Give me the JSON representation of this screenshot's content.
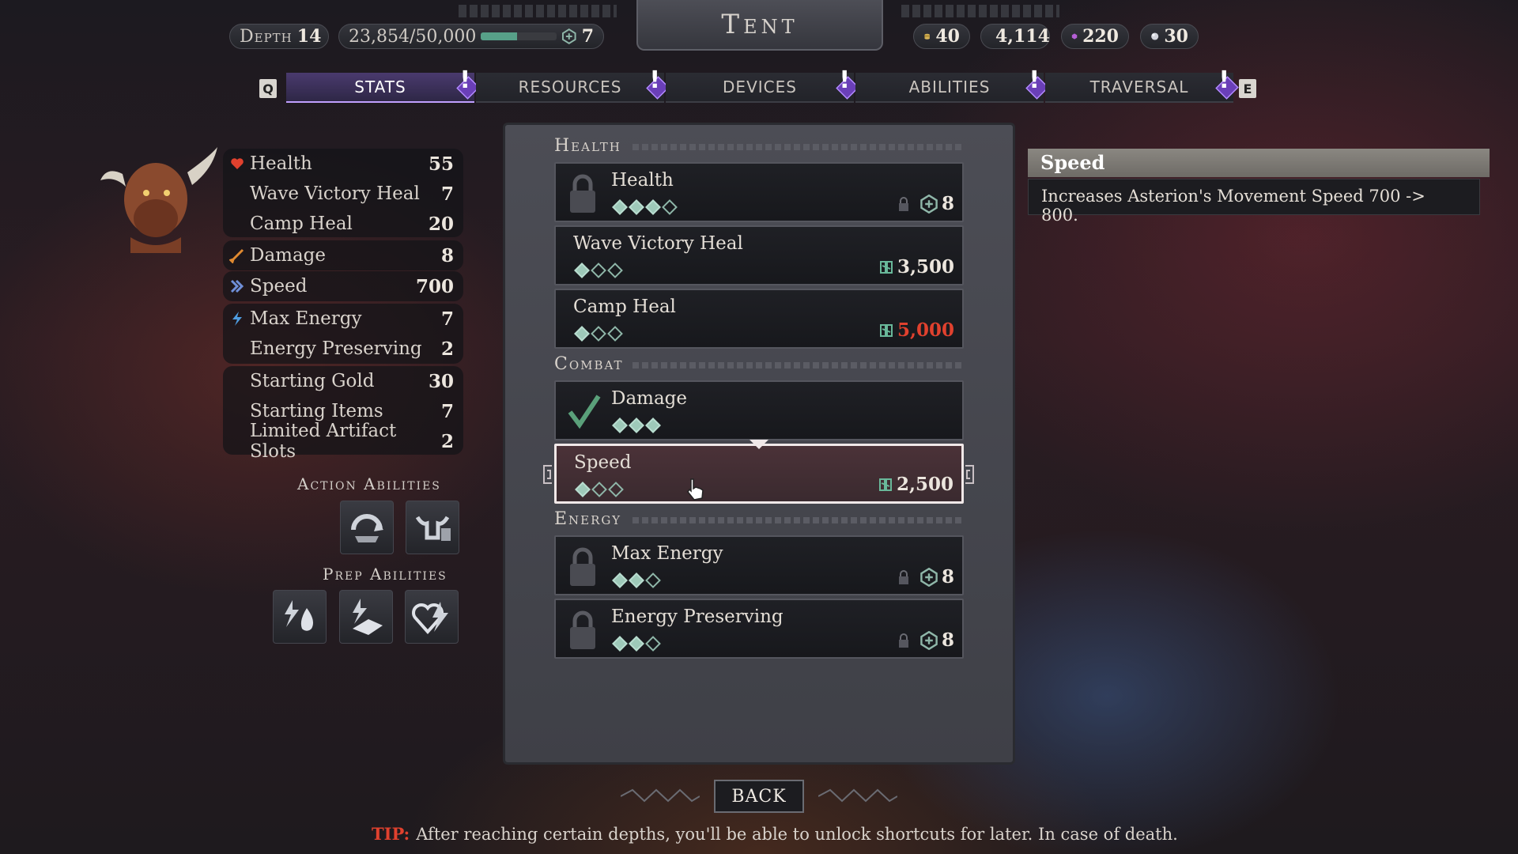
{
  "header": {
    "depth_label": "Depth",
    "depth_value": "14",
    "xp_text": "23,854/50,000",
    "xp_progress": 0.477,
    "level_value": "7",
    "title": "Tent",
    "currencies": [
      {
        "icon": "gold-coins-icon",
        "value": "40"
      },
      {
        "icon": "green-rune-icon",
        "value": "4,114"
      },
      {
        "icon": "purple-gem-icon",
        "value": "220"
      },
      {
        "icon": "silver-orb-icon",
        "value": "30"
      }
    ]
  },
  "tabs": {
    "prev_key": "Q",
    "next_key": "E",
    "items": [
      {
        "label": "STATS",
        "active": true
      },
      {
        "label": "RESOURCES",
        "active": false
      },
      {
        "label": "DEVICES",
        "active": false
      },
      {
        "label": "ABILITIES",
        "active": false
      },
      {
        "label": "TRAVERSAL",
        "active": false
      }
    ],
    "alert_mark": "!"
  },
  "stats": {
    "group1": [
      {
        "label": "Health",
        "value": "55",
        "icon": "heart-icon"
      },
      {
        "label": "Wave Victory Heal",
        "value": "7"
      },
      {
        "label": "Camp Heal",
        "value": "20"
      }
    ],
    "damage": {
      "label": "Damage",
      "value": "8",
      "icon": "sword-icon"
    },
    "speed": {
      "label": "Speed",
      "value": "700",
      "icon": "chevron-speed-icon"
    },
    "group4": [
      {
        "label": "Max Energy",
        "value": "7",
        "icon": "lightning-icon"
      },
      {
        "label": "Energy Preserving",
        "value": "2"
      }
    ],
    "group5": [
      {
        "label": "Starting Gold",
        "value": "30"
      },
      {
        "label": "Starting Items",
        "value": "7"
      },
      {
        "label": "Limited Artifact Slots",
        "value": "2"
      }
    ]
  },
  "abilities": {
    "action_label": "Action Abilities",
    "prep_label": "Prep Abilities"
  },
  "upgrades": {
    "health_category": "Health",
    "combat_category": "Combat",
    "energy_category": "Energy",
    "cards": {
      "health": {
        "name": "Health",
        "cost": "8",
        "pips_on": 3,
        "pips_total": 4,
        "locked": true
      },
      "wave_victory_heal": {
        "name": "Wave Victory Heal",
        "cost": "3,500",
        "pips_on": 1,
        "pips_total": 3
      },
      "camp_heal": {
        "name": "Camp Heal",
        "cost": "5,000",
        "pips_on": 1,
        "pips_total": 3,
        "cost_color": "#e0412e"
      },
      "damage": {
        "name": "Damage",
        "pips_on": 3,
        "pips_total": 3,
        "completed": true
      },
      "speed": {
        "name": "Speed",
        "cost": "2,500",
        "pips_on": 1,
        "pips_total": 3,
        "selected": true
      },
      "max_energy": {
        "name": "Max Energy",
        "cost": "8",
        "pips_on": 2,
        "pips_total": 3,
        "locked": true
      },
      "energy_preserving": {
        "name": "Energy Preserving",
        "cost": "8",
        "pips_on": 2,
        "pips_total": 3,
        "locked": true
      }
    }
  },
  "tooltip": {
    "title": "Speed",
    "text": "Increases Asterion's Movement Speed 700 -> 800."
  },
  "footer": {
    "back_label": "BACK",
    "tip_label": "TIP:",
    "tip_text": "After reaching certain depths, you'll be able to unlock shortcuts for later. In case of death."
  },
  "colors": {
    "accent_purple": "#6a3fb8",
    "pip_green": "#9ec9b9",
    "insufficient_red": "#e0412e"
  }
}
